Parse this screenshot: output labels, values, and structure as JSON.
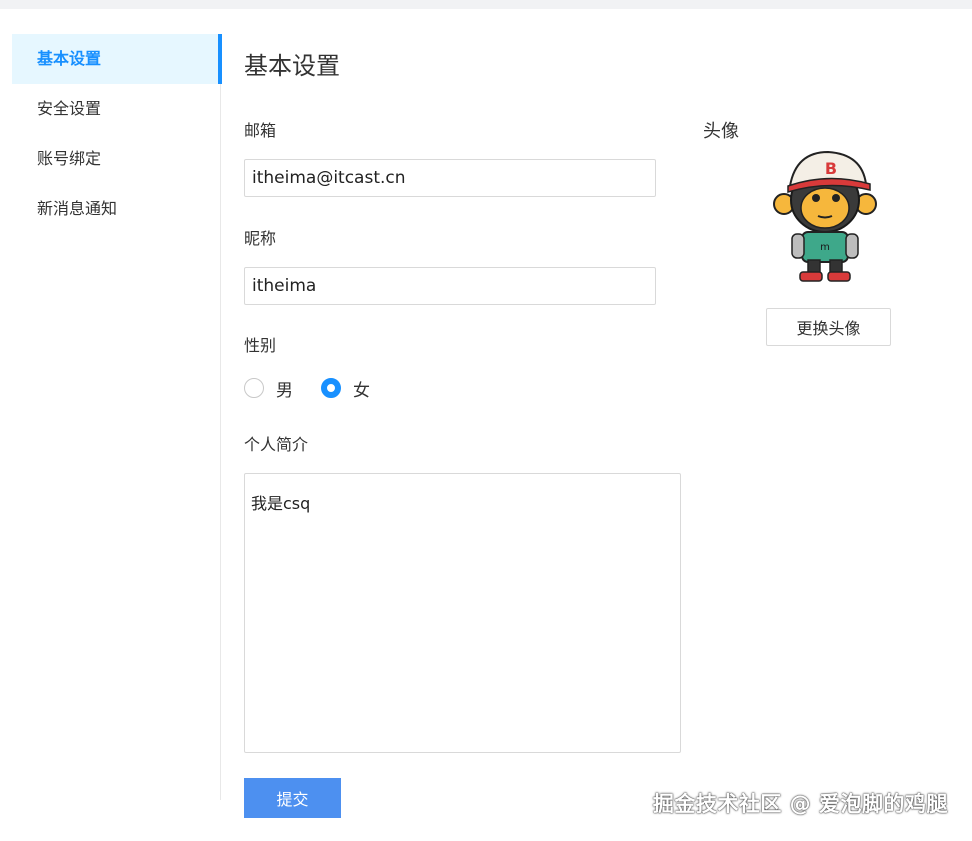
{
  "sidebar": {
    "items": [
      {
        "label": "基本设置"
      },
      {
        "label": "安全设置"
      },
      {
        "label": "账号绑定"
      },
      {
        "label": "新消息通知"
      }
    ],
    "active_index": 0
  },
  "main": {
    "title": "基本设置",
    "email": {
      "label": "邮箱",
      "value": "itheima@itcast.cn"
    },
    "nickname": {
      "label": "昵称",
      "value": "itheima"
    },
    "gender": {
      "label": "性别",
      "options": [
        {
          "label": "男",
          "checked": false
        },
        {
          "label": "女",
          "checked": true
        }
      ]
    },
    "bio": {
      "label": "个人简介",
      "value": "我是csq"
    },
    "submit_label": "提交"
  },
  "avatar": {
    "label": "头像",
    "cap_letter": "B",
    "shirt_letter": "m",
    "change_label": "更换头像"
  },
  "watermark": "掘金技术社区 @ 爱泡脚的鸡腿",
  "colors": {
    "accent": "#1890ff",
    "active_bg": "#e6f7ff",
    "submit_bg": "#4d90f0"
  }
}
